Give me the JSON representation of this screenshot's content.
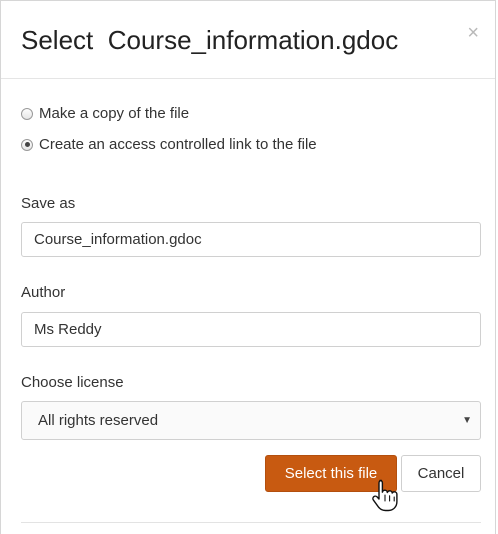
{
  "dialog": {
    "title": "Select  Course_information.gdoc",
    "close_label": "×"
  },
  "options": {
    "copy_label": "Make a copy of the file",
    "link_label": "Create an access controlled link to the file",
    "selected": "link"
  },
  "save_as": {
    "label": "Save as",
    "value": "Course_information.gdoc"
  },
  "author": {
    "label": "Author",
    "value": "Ms Reddy"
  },
  "license": {
    "label": "Choose license",
    "value": "All rights reserved",
    "arrow": "▼"
  },
  "buttons": {
    "select_label": "Select this file",
    "cancel_label": "Cancel"
  },
  "colors": {
    "primary": "#c85a11"
  },
  "icons": {
    "close": "close-icon",
    "cursor": "hand-pointer-icon",
    "dropdown": "chevron-down-icon"
  }
}
